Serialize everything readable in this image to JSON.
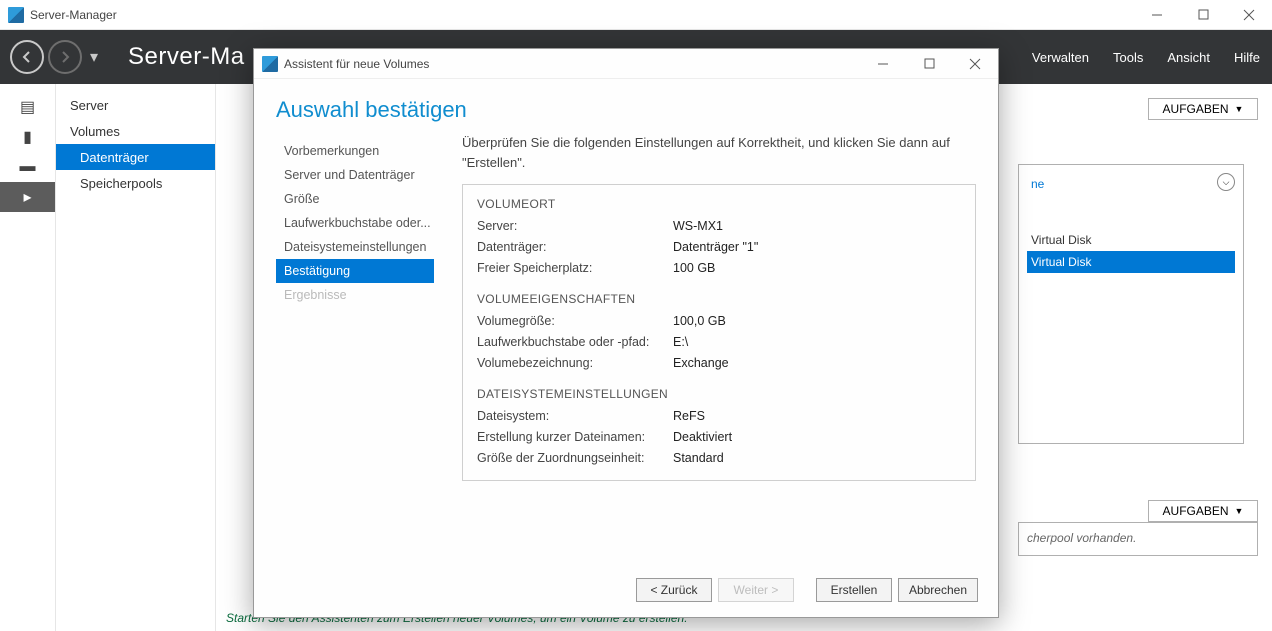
{
  "outer_window": {
    "title": "Server-Manager"
  },
  "header": {
    "banner_title": "Server-Ma",
    "menus": [
      "Verwalten",
      "Tools",
      "Ansicht",
      "Hilfe"
    ]
  },
  "sidebar": {
    "items": [
      {
        "label": "Server",
        "selected": false
      },
      {
        "label": "Volumes",
        "selected": false
      },
      {
        "label": "Datenträger",
        "selected": true,
        "indent": true
      },
      {
        "label": "Speicherpools",
        "selected": false,
        "indent": true
      }
    ]
  },
  "right_panel": {
    "tasks_button": "AUFGABEN",
    "link_text": "ne",
    "vd_items": [
      {
        "label": "Virtual Disk",
        "selected": false
      },
      {
        "label": "Virtual Disk",
        "selected": true
      }
    ],
    "tasks_button2": "AUFGABEN",
    "pool_hint": "cherpool vorhanden."
  },
  "main_hint": "Starten Sie den Assistenten zum Erstellen neuer Volumes, um ein Volume zu erstellen.",
  "modal": {
    "title": "Assistent für neue Volumes",
    "heading": "Auswahl bestätigen",
    "intro": "Überprüfen Sie die folgenden Einstellungen auf Korrektheit, und klicken Sie dann auf \"Erstellen\".",
    "steps": [
      {
        "label": "Vorbemerkungen"
      },
      {
        "label": "Server und Datenträger"
      },
      {
        "label": "Größe"
      },
      {
        "label": "Laufwerkbuchstabe oder..."
      },
      {
        "label": "Dateisystemeinstellungen"
      },
      {
        "label": "Bestätigung",
        "selected": true
      },
      {
        "label": "Ergebnisse",
        "disabled": true
      }
    ],
    "sections": [
      {
        "head": "VOLUMEORT",
        "rows": [
          {
            "k": "Server:",
            "v": "WS-MX1"
          },
          {
            "k": "Datenträger:",
            "v": "Datenträger \"1\""
          },
          {
            "k": "Freier Speicherplatz:",
            "v": "100 GB"
          }
        ]
      },
      {
        "head": "VOLUMEEIGENSCHAFTEN",
        "rows": [
          {
            "k": "Volumegröße:",
            "v": "100,0 GB"
          },
          {
            "k": "Laufwerkbuchstabe oder -pfad:",
            "v": "E:\\"
          },
          {
            "k": "Volumebezeichnung:",
            "v": "Exchange"
          }
        ]
      },
      {
        "head": "DATEISYSTEMEINSTELLUNGEN",
        "rows": [
          {
            "k": "Dateisystem:",
            "v": "ReFS"
          },
          {
            "k": "Erstellung kurzer Dateinamen:",
            "v": "Deaktiviert"
          },
          {
            "k": "Größe der Zuordnungseinheit:",
            "v": "Standard"
          }
        ]
      }
    ],
    "buttons": {
      "back": "< Zurück",
      "next": "Weiter >",
      "create": "Erstellen",
      "cancel": "Abbrechen"
    }
  }
}
